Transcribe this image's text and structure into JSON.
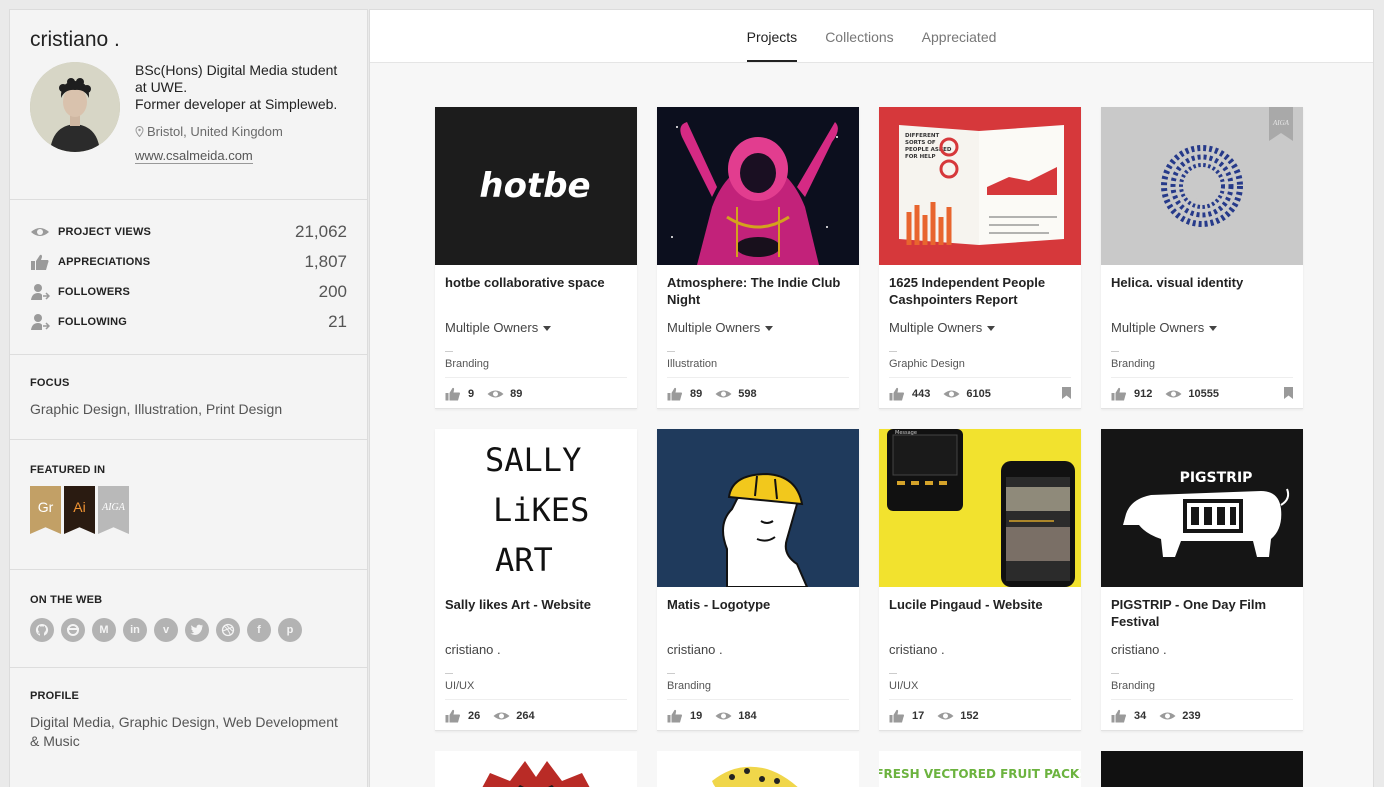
{
  "profile": {
    "name": "cristiano .",
    "bio": [
      "BSc(Hons) Digital Media student",
      "at UWE.",
      "Former developer at Simpleweb."
    ],
    "location": "Bristol, United Kingdom",
    "website": "www.csalmeida.com"
  },
  "stats": [
    {
      "icon": "eye-icon",
      "label": "PROJECT VIEWS",
      "value": "21,062"
    },
    {
      "icon": "thumbs-up-icon",
      "label": "APPRECIATIONS",
      "value": "1,807"
    },
    {
      "icon": "follower-icon",
      "label": "FOLLOWERS",
      "value": "200"
    },
    {
      "icon": "following-icon",
      "label": "FOLLOWING",
      "value": "21"
    }
  ],
  "focus": {
    "title": "FOCUS",
    "text": "Graphic Design, Illustration, Print Design"
  },
  "featured": {
    "title": "FEATURED IN",
    "badges": [
      {
        "label": "Gr",
        "color": "#c2a066"
      },
      {
        "label": "Ai",
        "color": "#2a1b11"
      },
      {
        "label": "AIGA",
        "color": "#b9b9b9"
      }
    ]
  },
  "web": {
    "title": "ON THE WEB",
    "icons": [
      "github-icon",
      "stackoverflow-icon",
      "medium-icon",
      "linkedin-icon",
      "vimeo-icon",
      "twitter-icon",
      "dribbble-icon",
      "facebook-icon",
      "pinterest-icon"
    ]
  },
  "profile_section": {
    "title": "PROFILE",
    "text": "Digital Media, Graphic Design, Web Development & Music"
  },
  "tabs": [
    "Projects",
    "Collections",
    "Appreciated"
  ],
  "active_tab": "Projects",
  "projects": [
    {
      "title": "hotbe collaborative space",
      "owner": "Multiple Owners",
      "owner_dropdown": true,
      "field": "Branding",
      "likes": "9",
      "views": "89",
      "bookmark": false
    },
    {
      "title": "Atmosphere: The Indie Club Night",
      "owner": "Multiple Owners",
      "owner_dropdown": true,
      "field": "Illustration",
      "likes": "89",
      "views": "598",
      "bookmark": false
    },
    {
      "title": "1625 Independent People Cashpointers Report",
      "owner": "Multiple Owners",
      "owner_dropdown": true,
      "field": "Graphic Design",
      "likes": "443",
      "views": "6105",
      "bookmark": true
    },
    {
      "title": "Helica. visual identity",
      "owner": "Multiple Owners",
      "owner_dropdown": true,
      "field": "Branding",
      "likes": "912",
      "views": "10555",
      "bookmark": true
    },
    {
      "title": "Sally likes Art - Website",
      "owner": "cristiano .",
      "owner_dropdown": false,
      "field": "UI/UX",
      "likes": "26",
      "views": "264",
      "bookmark": false
    },
    {
      "title": "Matis - Logotype",
      "owner": "cristiano .",
      "owner_dropdown": false,
      "field": "Branding",
      "likes": "19",
      "views": "184",
      "bookmark": false
    },
    {
      "title": "Lucile Pingaud - Website",
      "owner": "cristiano .",
      "owner_dropdown": false,
      "field": "UI/UX",
      "likes": "17",
      "views": "152",
      "bookmark": false
    },
    {
      "title": "PIGSTRIP - One Day Film Festival",
      "owner": "cristiano .",
      "owner_dropdown": false,
      "field": "Branding",
      "likes": "34",
      "views": "239",
      "bookmark": false
    }
  ],
  "thumb_text": {
    "hotbe": "hotbe",
    "report": [
      "DIFFERENT",
      "SORTS OF",
      "PEOPLE ASKED",
      "FOR HELP"
    ],
    "aiga": "AIGA",
    "sally": [
      "SALLY",
      "LiKES",
      "ART"
    ],
    "pigstrip": "PIGSTRIP",
    "lucile_msg": "Message",
    "fruit": "FRESH VECTORED FRUIT PACK!"
  }
}
